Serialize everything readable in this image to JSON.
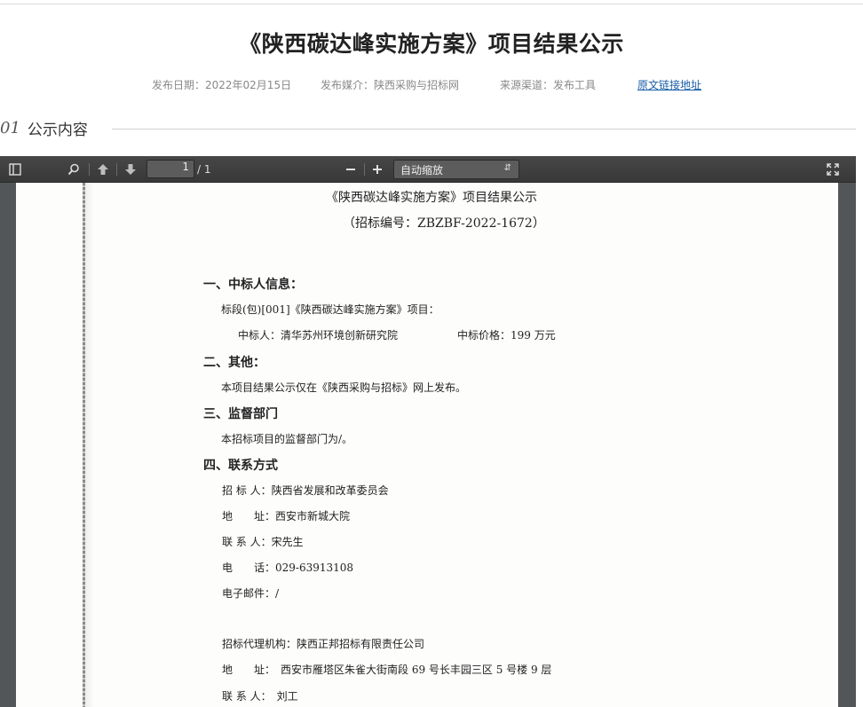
{
  "article": {
    "title": "《陕西碳达峰实施方案》项目结果公示",
    "meta": {
      "date": "发布日期：2022年02月15日",
      "media": "发布媒介：陕西采购与招标网",
      "source": "来源渠道：发布工具",
      "link": "原文链接地址"
    },
    "section": {
      "number": "01",
      "label": "公示内容"
    }
  },
  "viewer": {
    "page_current": "1",
    "page_total": "/ 1",
    "zoom": "自动缩放",
    "icons": [
      "sidebar-toggle-icon",
      "search-icon",
      "arrow-up-icon",
      "arrow-down-icon",
      "zoom-out-icon",
      "zoom-in-icon",
      "fullscreen-icon"
    ]
  },
  "document": {
    "title": "《陕西碳达峰实施方案》项目结果公示",
    "code": "（招标编号：ZBZBF-2022-1672）",
    "s1_heading": "一、中标人信息：",
    "s1_lot": "标段(包)[001]《陕西碳达峰实施方案》项目：",
    "s1_winner": "中标人：清华苏州环境创新研究院",
    "s1_price": "中标价格：199 万元",
    "s2_heading": "二、其他：",
    "s2_text": "本项目结果公示仅在《陕西采购与招标》网上发布。",
    "s3_heading": "三、监督部门",
    "s3_text": "本招标项目的监督部门为/。",
    "s4_heading": "四、联系方式",
    "c_tenderer": "招 标 人：陕西省发展和改革委员会",
    "c_address": "地　　址：西安市新城大院",
    "c_contact": "联 系 人：宋先生",
    "c_phone": "电　　话：029-63913108",
    "c_email": "电子邮件：/",
    "agency": "招标代理机构：陕西正邦招标有限责任公司",
    "agency_address": "地　　址：　西安市雁塔区朱雀大街南段 69 号长丰园三区 5 号楼 9 层",
    "agency_contact": "联 系 人：　刘工"
  }
}
